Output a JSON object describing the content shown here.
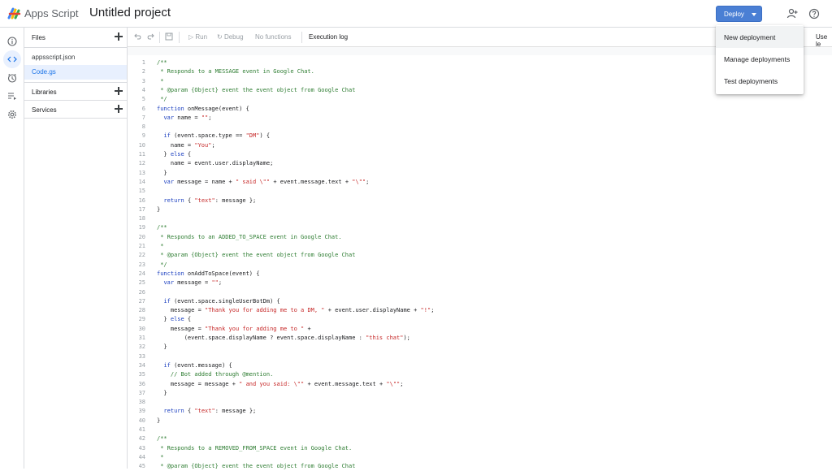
{
  "header": {
    "app_name": "Apps Script",
    "project_title": "Untitled project",
    "deploy_label": "Deploy",
    "icons": [
      "add-user-icon",
      "help-icon"
    ]
  },
  "rail": {
    "items": [
      "info-icon",
      "code-icon",
      "clock-icon",
      "executions-icon",
      "settings-icon"
    ],
    "active": "code-icon"
  },
  "files_panel": {
    "files_label": "Files",
    "files": [
      "appsscript.json",
      "Code.gs"
    ],
    "selected_file": "Code.gs",
    "libraries_label": "Libraries",
    "services_label": "Services"
  },
  "toolbar": {
    "run_label": "Run",
    "debug_label": "Debug",
    "function_label": "No functions",
    "execution_log_label": "Execution log",
    "use_label": "Use le"
  },
  "deploy_menu": {
    "items": [
      "New deployment",
      "Manage deployments",
      "Test deployments"
    ],
    "highlighted": "New deployment"
  },
  "colors": {
    "accent": "#1a73e8",
    "deploy_button": "#4a7fd4",
    "comment": "#2e7d32",
    "string": "#c62828",
    "keyword": "#1a3ebf"
  },
  "code": {
    "lines": [
      "/**",
      " * Responds to a MESSAGE event in Google Chat.",
      " *",
      " * @param {Object} event the event object from Google Chat",
      " */",
      "function onMessage(event) {",
      "  var name = \"\";",
      "",
      "  if (event.space.type == \"DM\") {",
      "    name = \"You\";",
      "  } else {",
      "    name = event.user.displayName;",
      "  }",
      "  var message = name + \" said \\\"\" + event.message.text + \"\\\"\";",
      "",
      "  return { \"text\": message };",
      "}",
      "",
      "/**",
      " * Responds to an ADDED_TO_SPACE event in Google Chat.",
      " *",
      " * @param {Object} event the event object from Google Chat",
      " */",
      "function onAddToSpace(event) {",
      "  var message = \"\";",
      "",
      "  if (event.space.singleUserBotDm) {",
      "    message = \"Thank you for adding me to a DM, \" + event.user.displayName + \"!\";",
      "  } else {",
      "    message = \"Thank you for adding me to \" +",
      "        (event.space.displayName ? event.space.displayName : \"this chat\");",
      "  }",
      "",
      "  if (event.message) {",
      "    // Bot added through @mention.",
      "    message = message + \" and you said: \\\"\" + event.message.text + \"\\\"\";",
      "  }",
      "",
      "  return { \"text\": message };",
      "}",
      "",
      "/**",
      " * Responds to a REMOVED_FROM_SPACE event in Google Chat.",
      " *",
      " * @param {Object} event the event object from Google Chat"
    ]
  }
}
